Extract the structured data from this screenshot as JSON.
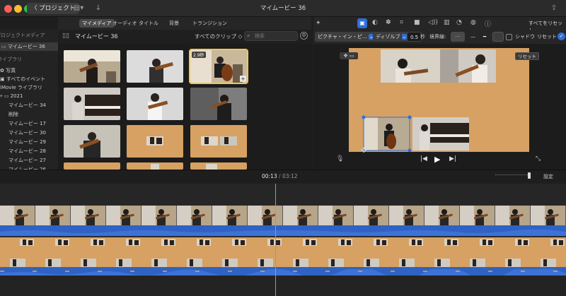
{
  "titlebar": {
    "back_label": "〈 プロジェクト",
    "title": "マイムービー 36",
    "reset_all": "すべてをリセット"
  },
  "sidebar": {
    "section_project_media": "プロジェクトメディア",
    "project_item": "マイムービー 36",
    "section_library": "ライブラリ",
    "items": [
      {
        "label": "写真"
      },
      {
        "label": "すべてのイベント"
      },
      {
        "label": "iMovie ライブラリ"
      },
      {
        "label": "2021"
      },
      {
        "label": "マイムービー 34"
      },
      {
        "label": "削除"
      },
      {
        "label": "マイムービー 17"
      },
      {
        "label": "マイムービー 30"
      },
      {
        "label": "マイムービー 29"
      },
      {
        "label": "マイムービー 28"
      },
      {
        "label": "マイムービー 27"
      },
      {
        "label": "マイムービー 26"
      }
    ]
  },
  "browser": {
    "tabs": [
      "マイメディア",
      "オーディオ",
      "タイトル",
      "背景",
      "トランジション"
    ],
    "active_tab": "マイメディア",
    "title": "マイムービー 36",
    "filter": "すべてのクリップ ◇",
    "search_placeholder": "検索",
    "selected_clip_duration": "2.9秒"
  },
  "viewer": {
    "overlay_mode": "ピクチャ・イン・ピ…",
    "transition_style": "ディゾルブ",
    "duration_value": "0.5",
    "seconds_label": "秒",
    "border_label": "境界線:",
    "shadow_label": "シャドウ",
    "reset_label": "リセット",
    "reset_tooltip": "リセット"
  },
  "timeline": {
    "current_time": "00:13",
    "separator": "/",
    "total_time": "03:12",
    "settings_label": "設定"
  },
  "colors": {
    "accent": "#2f6fd8",
    "canvas_bg": "#d6a162",
    "audio_wave": "#2f62c2",
    "selection_yellow": "#f2c94c"
  }
}
